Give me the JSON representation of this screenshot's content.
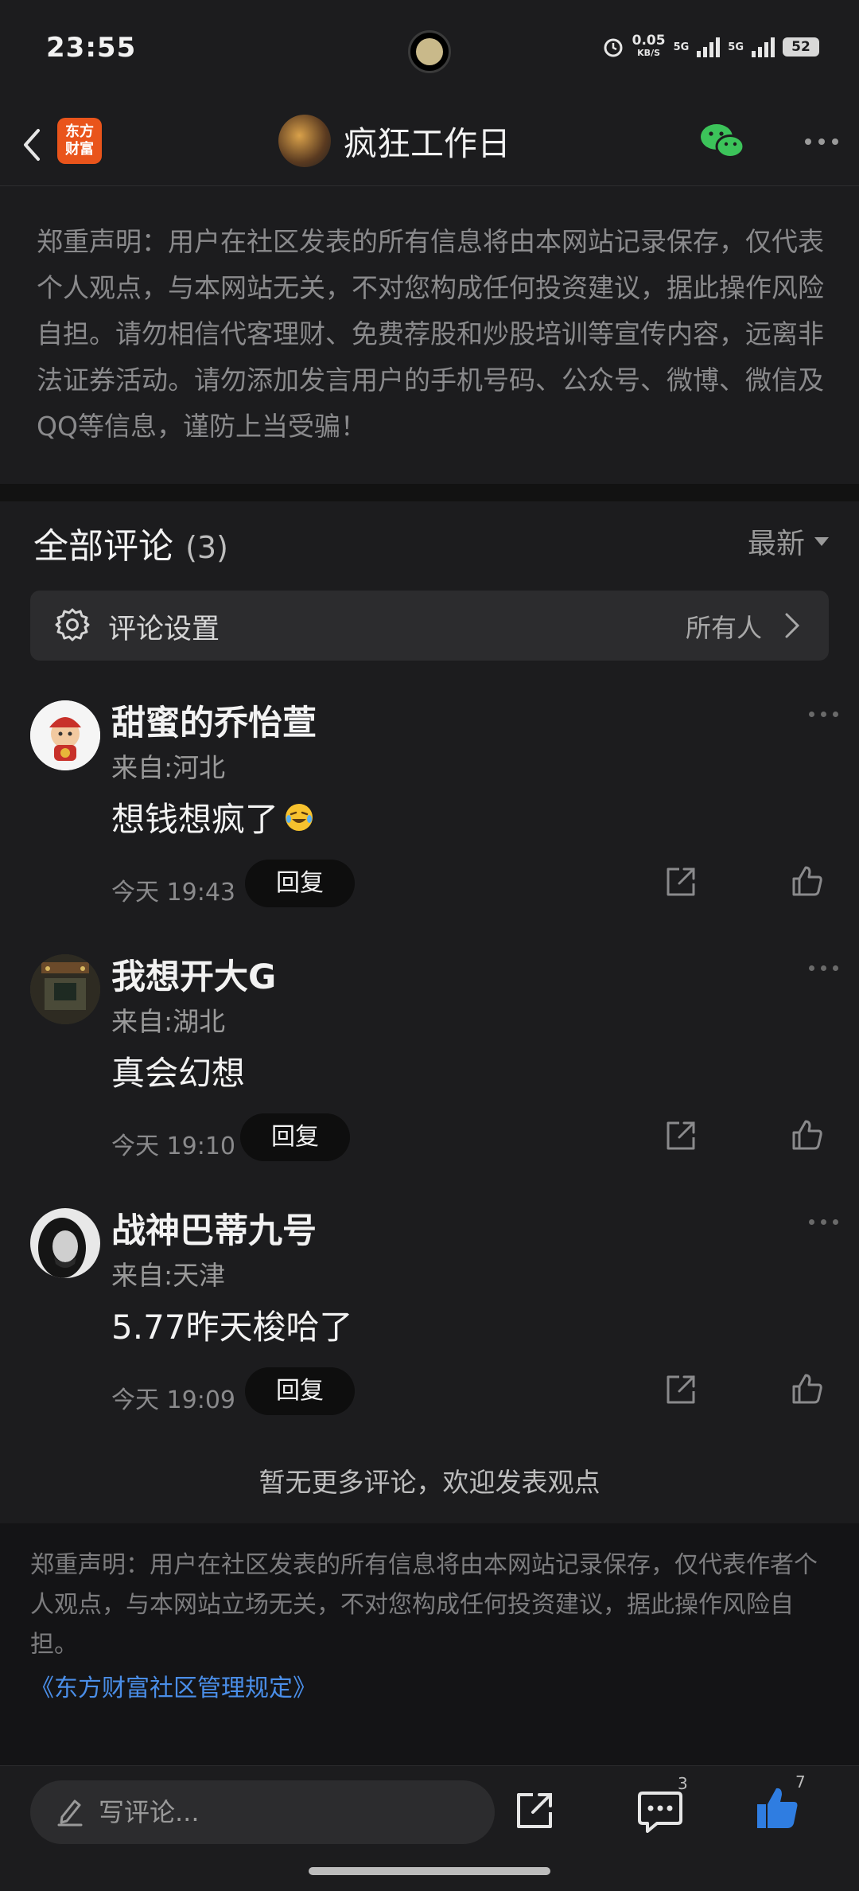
{
  "status_bar": {
    "time": "23:55",
    "net_speed": "0.05",
    "net_unit": "KB/S",
    "signal1": "5G",
    "signal2": "5G",
    "battery": "52"
  },
  "header": {
    "app_logo_line1": "东方",
    "app_logo_line2": "财富",
    "title": "疯狂工作日"
  },
  "disclaimer_top": "郑重声明：用户在社区发表的所有信息将由本网站记录保存，仅代表个人观点，与本网站无关，不对您构成任何投资建议，据此操作风险自担。请勿相信代客理财、免费荐股和炒股培训等宣传内容，远离非法证券活动。请勿添加发言用户的手机号码、公众号、微博、微信及QQ等信息，谨防上当受骗！",
  "comments_section": {
    "title": "全部评论",
    "count": "(3)",
    "sort_label": "最新"
  },
  "settings": {
    "label": "评论设置",
    "value": "所有人"
  },
  "comments": [
    {
      "name": "甜蜜的乔怡萱",
      "location": "来自:河北",
      "text": "想钱想疯了",
      "time": "今天 19:43",
      "reply_label": "回复"
    },
    {
      "name": "我想开大G",
      "location": "来自:湖北",
      "text": "真会幻想",
      "time": "今天 19:10",
      "reply_label": "回复"
    },
    {
      "name": "战神巴蒂九号",
      "location": "来自:天津",
      "text": "5.77昨天梭哈了",
      "time": "今天 19:09",
      "reply_label": "回复"
    }
  ],
  "no_more_text": "暂无更多评论，欢迎发表观点",
  "disclaimer_bottom": {
    "text": "郑重声明：用户在社区发表的所有信息将由本网站记录保存，仅代表作者个人观点，与本网站立场无关，不对您构成任何投资建议，据此操作风险自担。",
    "link": "《东方财富社区管理规定》"
  },
  "bottom_bar": {
    "input_placeholder": "写评论...",
    "comment_count": "3",
    "like_count": "7"
  },
  "colors": {
    "background": "#1c1c1e",
    "like_blue": "#2f7de1",
    "wechat_green": "#3cc35a",
    "brand_orange": "#e9541b"
  }
}
